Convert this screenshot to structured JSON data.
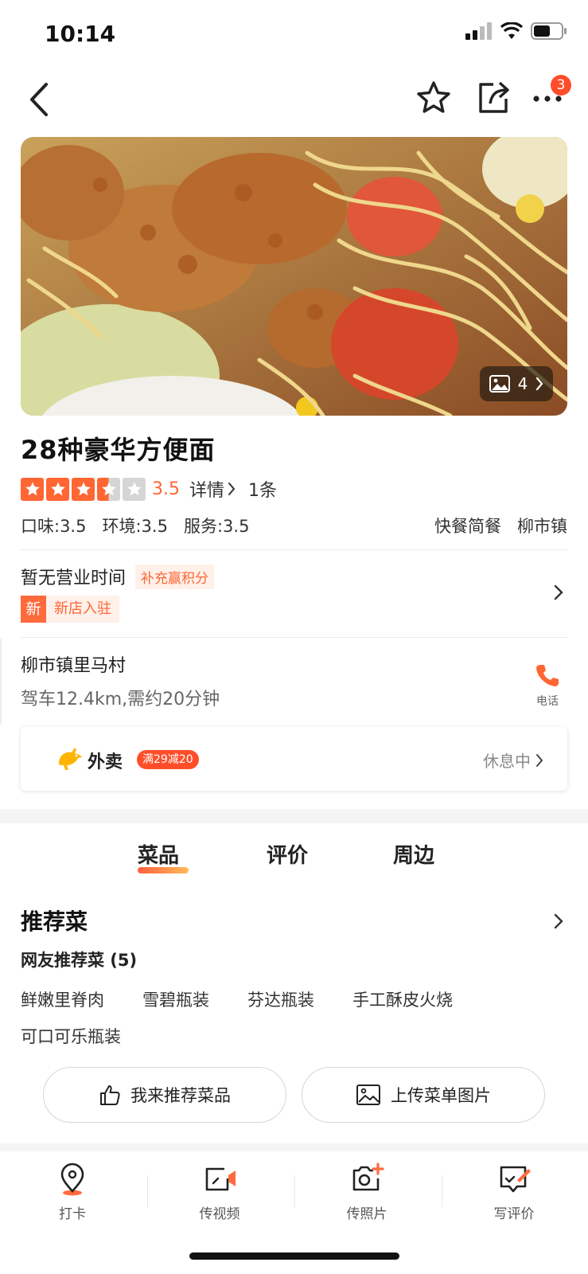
{
  "status_bar": {
    "time": "10:14"
  },
  "nav": {
    "notification_count": "3"
  },
  "hero": {
    "photo_count": "4"
  },
  "shop": {
    "name": "28种豪华方便面",
    "rating": {
      "stars": 3.5,
      "score": "3.5",
      "detail_label": "详情",
      "review_count": "1条"
    },
    "sub_scores": [
      "口味:3.5",
      "环境:3.5",
      "服务:3.5"
    ],
    "tags": [
      "快餐简餐",
      "柳市镇"
    ]
  },
  "hours": {
    "text": "暂无营业时间",
    "points_tag": "补充赢积分",
    "new_mark": "新",
    "new_text": "新店入驻"
  },
  "address": {
    "line": "柳市镇里马村",
    "drive": "驾车12.4km,需约20分钟",
    "phone_label": "电话"
  },
  "delivery": {
    "label": "外卖",
    "promo": "满29减20",
    "status": "休息中"
  },
  "tabs": [
    {
      "label": "菜品",
      "active": true
    },
    {
      "label": "评价",
      "active": false
    },
    {
      "label": "周边",
      "active": false
    }
  ],
  "recommend": {
    "title": "推荐菜",
    "subtitle": "网友推荐菜 (5)",
    "dishes": [
      "鲜嫩里脊肉",
      "雪碧瓶装",
      "芬达瓶装",
      "手工酥皮火烧",
      "可口可乐瓶装"
    ],
    "recommend_button": "我来推荐菜品",
    "upload_button": "上传菜单图片"
  },
  "bottom_bar": {
    "items": [
      {
        "label": "打卡",
        "icon": "location-pin-icon"
      },
      {
        "label": "传视频",
        "icon": "video-upload-icon"
      },
      {
        "label": "传照片",
        "icon": "photo-upload-icon"
      },
      {
        "label": "写评价",
        "icon": "write-review-icon"
      }
    ]
  },
  "colors": {
    "accent": "#ff6633",
    "badge": "#ff4d2a"
  }
}
